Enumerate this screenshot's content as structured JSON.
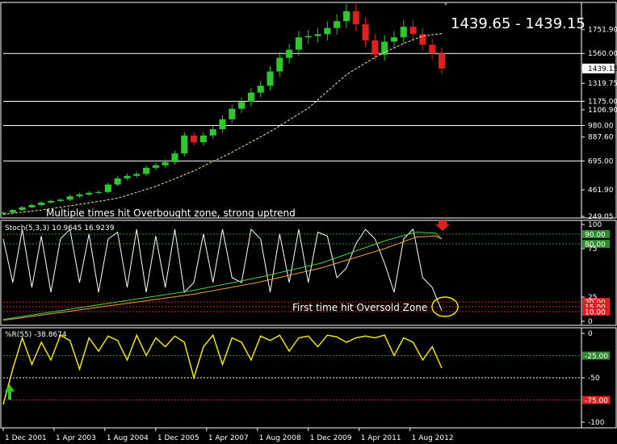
{
  "chart_data": [
    {
      "type": "candlestick",
      "panel": "price",
      "title": "1439.65 - 1439.15",
      "ylim": [
        249.05,
        1944.75
      ],
      "y_ticks": [
        "1751.90",
        "1560.00",
        "1439.15",
        "1319.75",
        "1175.00",
        "1106.90",
        "980.00",
        "887.60",
        "695.00",
        "461.90",
        "249.05"
      ],
      "horizontal_lines": [
        1560.0,
        1175.0,
        980.0,
        695.0
      ],
      "current_price": 1439.15,
      "annotation": "Multiple times hit Overbought zone, strong uptrend",
      "series": [
        {
          "name": "close",
          "x": [
            0,
            3,
            6,
            9,
            12,
            15,
            18,
            21,
            24,
            27,
            30,
            33,
            36,
            39,
            42,
            45,
            48,
            51,
            54,
            57,
            60,
            63,
            66,
            69,
            72,
            75,
            78,
            81,
            84,
            87,
            90,
            93,
            96,
            99,
            102,
            105,
            108,
            111,
            114,
            117,
            120,
            123,
            126,
            129,
            132,
            135,
            138
          ],
          "values": [
            279,
            300,
            322,
            340,
            360,
            373,
            383,
            410,
            425,
            438,
            445,
            505,
            555,
            575,
            590,
            640,
            660,
            685,
            755,
            900,
            845,
            900,
            950,
            1030,
            1115,
            1170,
            1245,
            1300,
            1415,
            1525,
            1590,
            1690,
            1700,
            1715,
            1765,
            1820,
            1900,
            1795,
            1665,
            1550,
            1655,
            1690,
            1775,
            1715,
            1630,
            1560,
            1439
          ]
        },
        {
          "name": "moving average",
          "style": "dashed",
          "x": [
            0,
            12,
            24,
            36,
            48,
            60,
            72,
            84,
            96,
            108,
            117,
            126,
            132,
            138
          ],
          "values": [
            265,
            300,
            345,
            395,
            490,
            615,
            765,
            930,
            1120,
            1390,
            1530,
            1640,
            1700,
            1720
          ]
        }
      ]
    },
    {
      "type": "line",
      "panel": "stochastic",
      "label": "Stoch(5,3,3) 10.9645 16.9239",
      "ylim": [
        0,
        100
      ],
      "y_ticks": [
        "100",
        "75",
        "25",
        "0"
      ],
      "levels": [
        {
          "label": "90.00",
          "value": 90,
          "color": "#2e8b2e"
        },
        {
          "label": "80.00",
          "value": 80,
          "color": "#2e8b2e"
        },
        {
          "label": "20.00",
          "value": 20,
          "color": "#e02020"
        },
        {
          "label": "15.00",
          "value": 15,
          "color": "#e02020"
        },
        {
          "label": "10.00",
          "value": 10,
          "color": "#e02020"
        }
      ],
      "annotation": "First time hit Oversold Zone",
      "series": [
        {
          "name": "%K",
          "color": "#ffffff",
          "x": [
            0,
            3,
            6,
            9,
            12,
            15,
            18,
            21,
            24,
            27,
            30,
            33,
            36,
            39,
            42,
            45,
            48,
            51,
            54,
            57,
            60,
            63,
            66,
            69,
            72,
            75,
            78,
            81,
            84,
            87,
            90,
            93,
            96,
            99,
            102,
            105,
            108,
            111,
            114,
            117,
            120,
            123,
            126,
            129,
            132,
            135,
            138
          ],
          "values": [
            85,
            40,
            95,
            35,
            88,
            30,
            85,
            95,
            40,
            90,
            30,
            85,
            92,
            35,
            95,
            30,
            88,
            35,
            95,
            30,
            40,
            90,
            40,
            95,
            45,
            40,
            95,
            85,
            30,
            90,
            40,
            95,
            40,
            92,
            88,
            45,
            55,
            80,
            95,
            85,
            60,
            30,
            85,
            95,
            45,
            35,
            11
          ]
        },
        {
          "name": "green MA",
          "color": "#4ad14a",
          "x": [
            0,
            20,
            40,
            60,
            80,
            100,
            120,
            130,
            136,
            138
          ],
          "values": [
            2,
            12,
            22,
            32,
            45,
            60,
            83,
            92,
            91,
            85
          ]
        },
        {
          "name": "orange MA",
          "color": "#f0a040",
          "x": [
            0,
            20,
            40,
            60,
            80,
            100,
            120,
            130,
            136,
            138
          ],
          "values": [
            1,
            10,
            19,
            28,
            40,
            55,
            75,
            87,
            88,
            85
          ]
        }
      ]
    },
    {
      "type": "line",
      "panel": "williams_r",
      "label": "%R(55) -38.8674",
      "ylim": [
        -100,
        0
      ],
      "y_ticks": [
        "0",
        "-50",
        "-100"
      ],
      "levels": [
        {
          "label": "-25.00",
          "value": -25,
          "color": "#2e8b2e"
        },
        {
          "label": "-75.00",
          "value": -75,
          "color": "#e02020"
        }
      ],
      "series": [
        {
          "name": "%R(55)",
          "color": "#f2e600",
          "x": [
            0,
            3,
            6,
            9,
            12,
            15,
            18,
            21,
            24,
            27,
            30,
            33,
            36,
            39,
            42,
            45,
            48,
            51,
            54,
            57,
            60,
            63,
            66,
            69,
            72,
            75,
            78,
            81,
            84,
            87,
            90,
            93,
            96,
            99,
            102,
            105,
            108,
            111,
            114,
            117,
            120,
            123,
            126,
            129,
            132,
            135,
            138
          ],
          "values": [
            -80,
            -40,
            -5,
            -35,
            -10,
            -30,
            -2,
            -8,
            -40,
            -5,
            -20,
            -3,
            -8,
            -30,
            -2,
            -25,
            -5,
            -15,
            -3,
            -10,
            -50,
            -15,
            -2,
            -35,
            -5,
            -10,
            -30,
            -3,
            -8,
            -2,
            -20,
            -5,
            -3,
            -15,
            -2,
            -4,
            -10,
            -5,
            -3,
            -5,
            -2,
            -25,
            -5,
            -10,
            -30,
            -15,
            -39
          ]
        }
      ]
    }
  ],
  "x_axis": {
    "labels": [
      "1 Dec 2001",
      "1 Apr 2003",
      "1 Aug 2004",
      "1 Dec 2005",
      "1 Apr 2007",
      "1 Aug 2008",
      "1 Dec 2009",
      "1 Apr 2011",
      "1 Aug 2012"
    ],
    "label_x": [
      0,
      16,
      32,
      48,
      64,
      80,
      96,
      112,
      128
    ]
  },
  "colors": {
    "up": "#2fc62f",
    "down": "#e02020",
    "bg": "#000000",
    "grid": "#ffffff"
  }
}
